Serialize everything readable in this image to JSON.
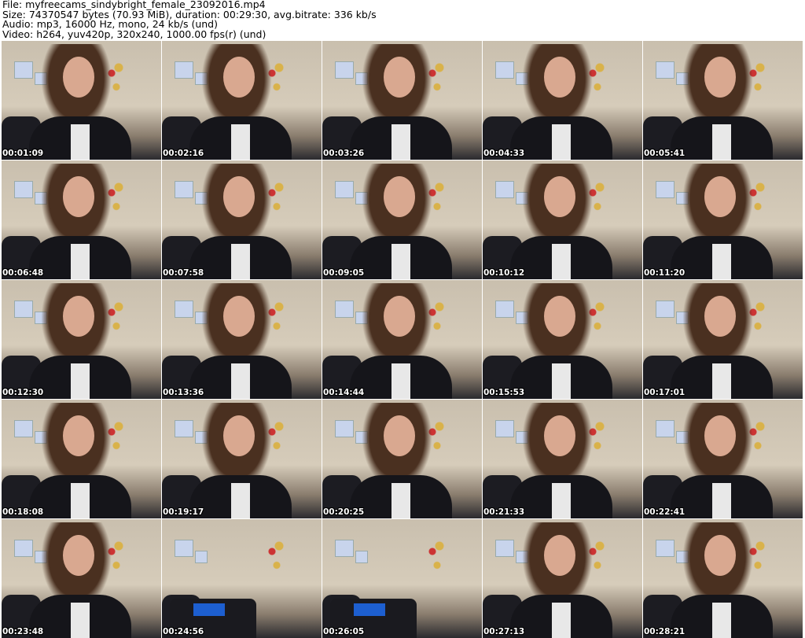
{
  "header": {
    "file": "File: myfreecams_sindybright_female_23092016.mp4",
    "size": "Size: 74370547 bytes (70.93 MiB), duration: 00:29:30, avg.bitrate: 336 kb/s",
    "audio": "Audio: mp3, 16000 Hz, mono, 24 kb/s (und)",
    "video": "Video: h264, yuv420p, 320x240, 1000.00 fps(r) (und)"
  },
  "thumbnails": [
    {
      "timestamp": "00:01:09"
    },
    {
      "timestamp": "00:02:16"
    },
    {
      "timestamp": "00:03:26"
    },
    {
      "timestamp": "00:04:33"
    },
    {
      "timestamp": "00:05:41"
    },
    {
      "timestamp": "00:06:48"
    },
    {
      "timestamp": "00:07:58"
    },
    {
      "timestamp": "00:09:05"
    },
    {
      "timestamp": "00:10:12"
    },
    {
      "timestamp": "00:11:20"
    },
    {
      "timestamp": "00:12:30"
    },
    {
      "timestamp": "00:13:36"
    },
    {
      "timestamp": "00:14:44"
    },
    {
      "timestamp": "00:15:53"
    },
    {
      "timestamp": "00:17:01"
    },
    {
      "timestamp": "00:18:08"
    },
    {
      "timestamp": "00:19:17"
    },
    {
      "timestamp": "00:20:25"
    },
    {
      "timestamp": "00:21:33"
    },
    {
      "timestamp": "00:22:41"
    },
    {
      "timestamp": "00:23:48"
    },
    {
      "timestamp": "00:24:56",
      "empty": true
    },
    {
      "timestamp": "00:26:05",
      "empty": true
    },
    {
      "timestamp": "00:27:13"
    },
    {
      "timestamp": "00:28:21"
    }
  ]
}
